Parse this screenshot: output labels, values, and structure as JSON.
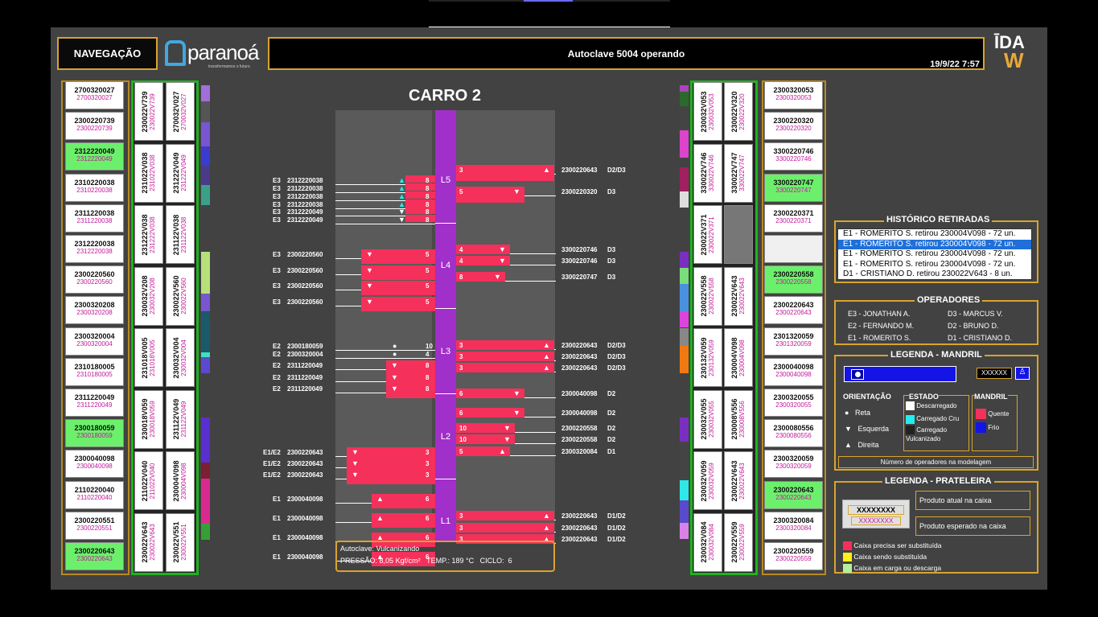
{
  "header": {
    "nav_label": "NAVEGAÇÃO",
    "logo_name": "paranoá",
    "logo_tagline": "transformamos o futuro",
    "title": "Autoclave 5004 operando",
    "datetime": "19/9/22 7:57",
    "brand": "DAW"
  },
  "left_col": [
    [
      "2700320027",
      "2700320027",
      ""
    ],
    [
      "2300220739",
      "2300220739",
      ""
    ],
    [
      "2312220049",
      "2312220049",
      "g"
    ],
    [
      "2310220038",
      "2310220038",
      ""
    ],
    [
      "2311220038",
      "2311220038",
      ""
    ],
    [
      "2312220038",
      "2312220038",
      ""
    ],
    [
      "2300220560",
      "2300220560",
      ""
    ],
    [
      "2300320208",
      "2300320208",
      ""
    ],
    [
      "2300320004",
      "2300320004",
      ""
    ],
    [
      "2310180005",
      "2310180005",
      ""
    ],
    [
      "2311220049",
      "2311220049",
      ""
    ],
    [
      "2300180059",
      "2300180059",
      "g"
    ],
    [
      "2300040098",
      "2300040098",
      ""
    ],
    [
      "2110220040",
      "2110220040",
      ""
    ],
    [
      "2300220551",
      "2300220551",
      ""
    ],
    [
      "2300220643",
      "2300220643",
      "g"
    ]
  ],
  "left_vcols": [
    [
      "230022V739",
      "230022V739"
    ],
    [
      "231022V038",
      "231022V038"
    ],
    [
      "231222V038",
      "231222V038"
    ],
    [
      "230032V208",
      "230032V208"
    ],
    [
      "231018V005",
      "231018V005"
    ],
    [
      "230018V059",
      "230018V059"
    ],
    [
      "211022V040",
      "211022V040"
    ],
    [
      "230022V643",
      "230022V643"
    ]
  ],
  "left_vcols2": [
    [
      "270032V027",
      "270032V027"
    ],
    [
      "231222V049",
      "231222V049"
    ],
    [
      "231122V038",
      "231122V038"
    ],
    [
      "230022V560",
      "230022V560"
    ],
    [
      "230032V004",
      "230032V004"
    ],
    [
      "231122V049",
      "231122V049"
    ],
    [
      "230004V098",
      "230004V098"
    ],
    [
      "230022V551",
      "230022V551"
    ]
  ],
  "right_vcols": [
    [
      "230032V053",
      "230032V053"
    ],
    [
      "330022V746",
      "330022V746"
    ],
    [
      "230022V371",
      "230022V371"
    ],
    [
      "230022V558",
      "230022V558"
    ],
    [
      "230132V059",
      "230132V059"
    ],
    [
      "230032V055",
      "230032V055"
    ],
    [
      "230032V059",
      "230032V059"
    ],
    [
      "230032V084",
      "230032V084"
    ]
  ],
  "right_vcols2": [
    [
      "230022V320",
      "230022V320"
    ],
    [
      "330022V747",
      "330022V747"
    ],
    [
      "",
      ""
    ],
    [
      "230022V643",
      "230022V643"
    ],
    [
      "230004V098",
      "230004V098"
    ],
    [
      "230008V556",
      "230008V556"
    ],
    [
      "230022V643",
      "230022V643"
    ],
    [
      "230022V559",
      "230022V559"
    ]
  ],
  "right_col": [
    [
      "2300320053",
      "2300320053",
      ""
    ],
    [
      "2300220320",
      "2300220320",
      ""
    ],
    [
      "3300220746",
      "3300220746",
      ""
    ],
    [
      "3300220747",
      "3300220747",
      "g"
    ],
    [
      "2300220371",
      "2300220371",
      ""
    ],
    [
      "",
      "",
      "e"
    ],
    [
      "2300220558",
      "2300220558",
      "g"
    ],
    [
      "2300220643",
      "2300220643",
      ""
    ],
    [
      "2301320059",
      "2301320059",
      ""
    ],
    [
      "2300040098",
      "2300040098",
      ""
    ],
    [
      "2300320055",
      "2300320055",
      ""
    ],
    [
      "2300080556",
      "2300080556",
      ""
    ],
    [
      "2300320059",
      "2300320059",
      ""
    ],
    [
      "2300220643",
      "2300220643",
      "g"
    ],
    [
      "2300320084",
      "2300320084",
      ""
    ],
    [
      "2300220559",
      "2300220559",
      ""
    ]
  ],
  "carro": "CARRO 2",
  "levels": [
    "L5",
    "L4",
    "L3",
    "L2",
    "L1"
  ],
  "left_rows": [
    [
      "E3",
      "2312220038",
      "8",
      "up"
    ],
    [
      "E3",
      "2312220038",
      "8",
      "up"
    ],
    [
      "E3",
      "2312220038",
      "8",
      "up"
    ],
    [
      "E3",
      "2312220038",
      "8",
      "up"
    ],
    [
      "E3",
      "2312220049",
      "8",
      "down"
    ],
    [
      "E3",
      "2312220049",
      "8",
      "down"
    ],
    [
      "E3",
      "2300220560",
      "5",
      "down"
    ],
    [
      "E3",
      "2300220560",
      "5",
      "down"
    ],
    [
      "E3",
      "2300220560",
      "5",
      "down"
    ],
    [
      "E3",
      "2300220560",
      "5",
      "down"
    ],
    [
      "E2",
      "2300180059",
      "10",
      "dot"
    ],
    [
      "E2",
      "2300320004",
      "4",
      "dot"
    ],
    [
      "E2",
      "2311220049",
      "8",
      "down"
    ],
    [
      "E2",
      "2311220049",
      "8",
      "down"
    ],
    [
      "E2",
      "2311220049",
      "8",
      "down"
    ],
    [
      "E1/E2",
      "2300220643",
      "3",
      "down"
    ],
    [
      "E1/E2",
      "2300220643",
      "3",
      "down"
    ],
    [
      "E1/E2",
      "2300220643",
      "3",
      "down"
    ],
    [
      "E1",
      "2300040098",
      "6",
      "up"
    ],
    [
      "E1",
      "2300040098",
      "6",
      "up"
    ],
    [
      "E1",
      "2300040098",
      "6",
      "up"
    ],
    [
      "E1",
      "2300040098",
      "6",
      "up"
    ]
  ],
  "right_rows": [
    [
      "3",
      "2300220643",
      "D2/D3",
      "up"
    ],
    [
      "5",
      "2300220320",
      "D3",
      "down"
    ],
    [
      "4",
      "3300220746",
      "D3",
      "down"
    ],
    [
      "4",
      "3300220746",
      "D3",
      "down"
    ],
    [
      "8",
      "3300220747",
      "D3",
      "down"
    ],
    [
      "3",
      "2300220643",
      "D2/D3",
      "up"
    ],
    [
      "3",
      "2300220643",
      "D2/D3",
      "up"
    ],
    [
      "3",
      "2300220643",
      "D2/D3",
      "up"
    ],
    [
      "6",
      "2300040098",
      "D2",
      "down"
    ],
    [
      "6",
      "2300040098",
      "D2",
      "down"
    ],
    [
      "10",
      "2300220558",
      "D2",
      "down"
    ],
    [
      "10",
      "2300220558",
      "D2",
      "down"
    ],
    [
      "5",
      "2300320084",
      "D1",
      "up"
    ],
    [
      "3",
      "2300220643",
      "D1/D2",
      "up"
    ],
    [
      "3",
      "2300220643",
      "D1/D2",
      "up"
    ],
    [
      "3",
      "2300220643",
      "D1/D2",
      "up"
    ]
  ],
  "status": {
    "line1": "Autoclave: Vulcanizando",
    "pressao_label": "PRESSÃO:",
    "pressao": "8,05",
    "pressao_unit": "Kgf/cm²",
    "temp_label": "TEMP.:",
    "temp": "189",
    "temp_unit": "°C",
    "ciclo_label": "CICLO:",
    "ciclo": "6"
  },
  "historico": {
    "title": "HISTÓRICO RETIRADAS",
    "items": [
      "E1 - ROMERITO S. retirou 230004V098 - 72 un.",
      "E1 - ROMERITO S. retirou 230004V098 - 72 un.",
      "E1 - ROMERITO S. retirou 230004V098 - 72 un.",
      "E1 - ROMERITO S. retirou 230004V098 - 72 un.",
      "D1 - CRISTIANO D. retirou 230022V643 - 8 un."
    ]
  },
  "operadores": {
    "title": "OPERADORES",
    "list": [
      "E3 - JONATHAN A.",
      "D3 - MARCUS V.",
      "E2 - FERNANDO M.",
      "D2 - BRUNO D.",
      "E1 - ROMERITO S.",
      "D1 - CRISTIANO D."
    ]
  },
  "mandril": {
    "title": "LEGENDA  - MANDRIL",
    "placeholder": "XXXXXX",
    "orient_title": "ORIENTAÇÃO",
    "orient": [
      "Reta",
      "Esquerda",
      "Direita"
    ],
    "estado_title": "ESTADO",
    "estado": [
      "Descarregado",
      "Carregado Cru",
      "Carregado Vulcanizado"
    ],
    "mandril_title": "MANDRIL",
    "mandril": [
      "Quente",
      "Frio"
    ],
    "footer": "Número de operadores na modelagem"
  },
  "prateleira": {
    "title": "LEGENDA  - PRATELEIRA",
    "ph1": "XXXXXXXX",
    "ph2": "XXXXXXXX",
    "atual": "Produto atual na caixa",
    "esperado": "Produto esperado na caixa",
    "l1": "Caixa precisa ser substituída",
    "l2": "Caixa sendo substituída",
    "l3": "Caixa em carga ou descarga"
  },
  "colors": {
    "accent": "#d9a42c",
    "bar": "#f5305b",
    "level": "#a12fc9",
    "green": "#6cf06c"
  }
}
